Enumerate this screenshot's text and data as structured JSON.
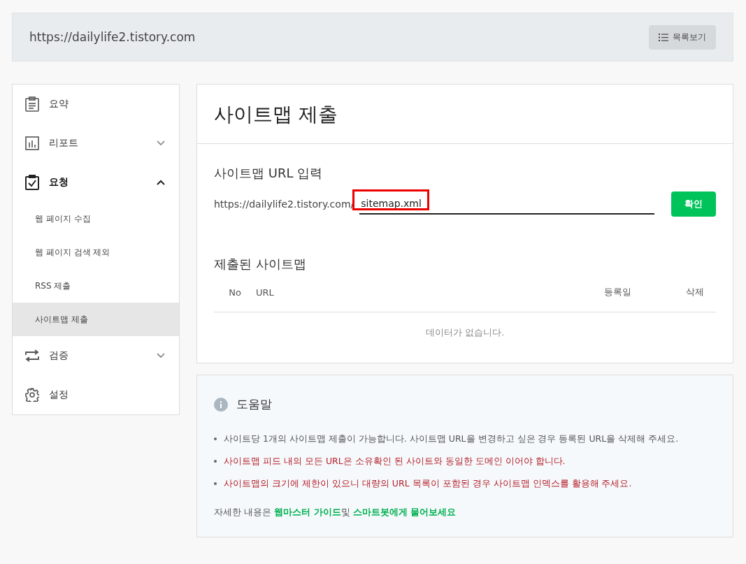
{
  "header": {
    "site_url": "https://dailylife2.tistory.com",
    "list_button": "목록보기"
  },
  "sidebar": {
    "items": [
      {
        "label": "요약",
        "selected": false
      },
      {
        "label": "리포트",
        "selected": false,
        "expanded": false
      },
      {
        "label": "요청",
        "selected": true,
        "expanded": true,
        "children": [
          {
            "label": "웹 페이지 수집",
            "selected": false
          },
          {
            "label": "웹 페이지 검색 제외",
            "selected": false
          },
          {
            "label": "RSS 제출",
            "selected": false
          },
          {
            "label": "사이트맵 제출",
            "selected": true
          }
        ]
      },
      {
        "label": "검증",
        "selected": false,
        "expanded": false
      },
      {
        "label": "설정",
        "selected": false
      }
    ]
  },
  "page_title": "사이트맵 제출",
  "url_form": {
    "heading": "사이트맵 URL 입력",
    "prefix": "https://dailylife2.tistory.com/",
    "value": "sitemap.xml",
    "highlighted": true,
    "submit": "확인"
  },
  "submitted": {
    "heading": "제출된 사이트맵",
    "columns": [
      "No",
      "URL",
      "등록일",
      "삭제"
    ],
    "empty": "데이터가 없습니다."
  },
  "help": {
    "title": "도움말",
    "notes": [
      {
        "kind": "normal",
        "text": "사이트당 1개의 사이트맵 제출이 가능합니다. 사이트맵 URL을 변경하고 싶은 경우 등록된 URL을 삭제해 주세요."
      },
      {
        "kind": "warning",
        "text": "사이트맵 피드 내의 모든 URL은 소유확인 된 사이트와 동일한 도메인 이어야 합니다."
      },
      {
        "kind": "warning",
        "text": "사이트맵의 크기에 제한이 있으니 대량의 URL 목록이 포함된 경우 사이트맵 인덱스를 활용해 주세요."
      }
    ],
    "footer": [
      {
        "kind": "text",
        "text": "자세한 내용은"
      },
      {
        "kind": "link",
        "text": "웹마스터 가이드"
      },
      {
        "kind": "text",
        "text": "및"
      },
      {
        "kind": "link",
        "text": "스마트봇에게 물어보세요"
      }
    ]
  }
}
